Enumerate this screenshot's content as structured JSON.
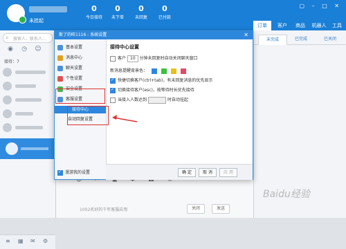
{
  "header": {
    "status": "未挂起",
    "stats": [
      {
        "value": "0",
        "label": "今日接待"
      },
      {
        "value": "0",
        "label": "未下单"
      },
      {
        "value": "0",
        "label": "未回复"
      },
      {
        "value": "0",
        "label": "已付款"
      }
    ],
    "tabs": [
      "订单",
      "客户",
      "商品",
      "机器人",
      "工具"
    ],
    "window_controls": "▢ – □ ✕"
  },
  "left": {
    "search_placeholder": "搜索人、联系人...",
    "queue_label": "接待：7"
  },
  "right": {
    "tabs": [
      "未完成",
      "已完成",
      "已关闭"
    ]
  },
  "dialog": {
    "title": "斯了的旺1116 - 系统设置",
    "close": "✕",
    "nav": [
      {
        "label": "基本设置",
        "color": "#4a90d9"
      },
      {
        "label": "消息中心",
        "color": "#e0a020"
      },
      {
        "label": "聊天设置",
        "color": "#4a90d9"
      },
      {
        "label": "个性设置",
        "color": "#e05050"
      },
      {
        "label": "安全设置",
        "color": "#50b050"
      },
      {
        "label": "客服设置",
        "color": "#4a90d9"
      }
    ],
    "nav_sub": [
      "接待中心",
      "自动回复设置"
    ],
    "content": {
      "title": "接待中心设置",
      "row1_pre": "客户",
      "row1_select": "10",
      "row1_post": "分钟未回复时自动关闭聊天窗口",
      "row2": "新消息提醒背景色：",
      "swatches": [
        "#2d87dc",
        "#3fbf3f",
        "#e8c01c",
        "#e24a6a"
      ],
      "row3": "快捷切换客户(ctrl+tab)，有未回复消息的优先显示",
      "row4": "切换接待客户(esc)，按等待时长优先接待",
      "row5_pre": "当接入人数达到",
      "row5_post": "时自动挂起"
    },
    "footer": {
      "checkbox": "漫游我的设置",
      "ok": "确 定",
      "cancel": "取 消",
      "apply": "应 用"
    }
  },
  "chat": {
    "toolbar_icons": "☺ ✂ ▣ ✱ ☎ ≡",
    "input_hint": "1002名好的千年客服应用",
    "close_btn": "关闭",
    "send_btn": "发送"
  },
  "watermark": "Baidu经验",
  "annotation": {
    "color": "#e03030"
  }
}
